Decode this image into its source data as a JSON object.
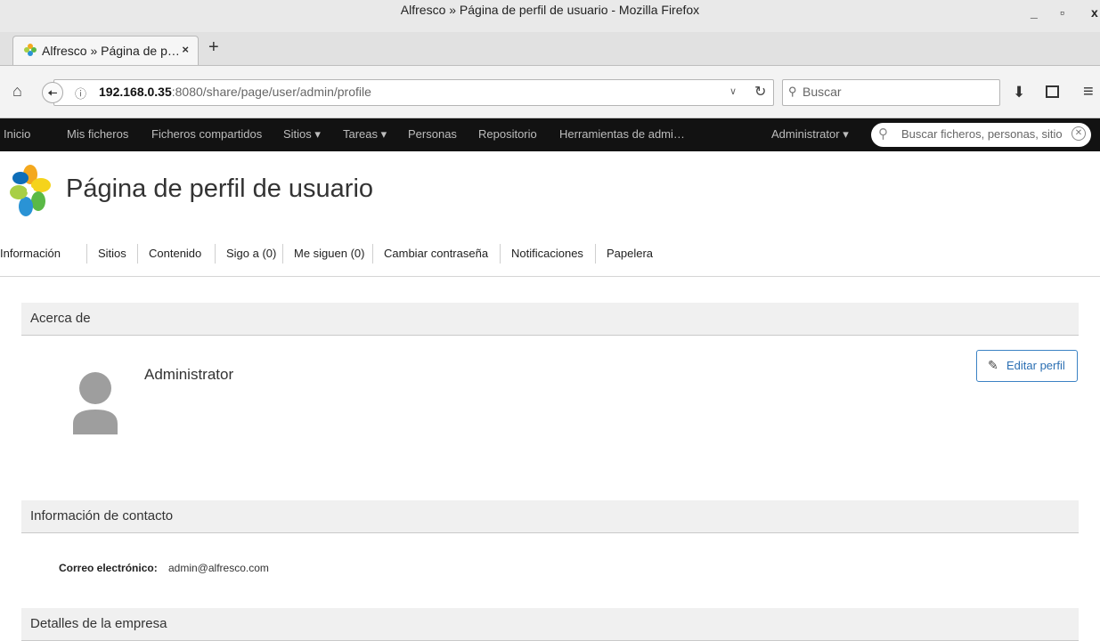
{
  "window": {
    "title": "Alfresco » Página de perfil de usuario - Mozilla Firefox",
    "minimize": "_",
    "maximize": "▫",
    "close": "x"
  },
  "browser": {
    "tab_title": "Alfresco » Página de p…",
    "tab_close": "×",
    "new_tab": "+",
    "url_host": "192.168.0.35",
    "url_rest": ":8080/share/page/user/admin/profile",
    "search_placeholder": "Buscar"
  },
  "app_nav": {
    "items": [
      "Inicio",
      "Mis ficheros",
      "Ficheros compartidos",
      "Sitios ▾",
      "Tareas ▾",
      "Personas",
      "Repositorio",
      "Herramientas de admi…"
    ],
    "user_menu": "Administrator ▾",
    "search_placeholder": "Buscar ficheros, personas, sitios"
  },
  "page": {
    "title": "Página de perfil de usuario"
  },
  "profile_tabs": [
    "Información",
    "Sitios",
    "Contenido",
    "Sigo a (0)",
    "Me siguen (0)",
    "Cambiar contraseña",
    "Notificaciones",
    "Papelera"
  ],
  "about": {
    "heading": "Acerca de",
    "name": "Administrator",
    "edit_label": "Editar perfil"
  },
  "contact": {
    "heading": "Información de contacto",
    "email_label": "Correo electrónico:",
    "email_value": "admin@alfresco.com"
  },
  "company": {
    "heading": "Detalles de la empresa"
  },
  "colors": {
    "nav_bg": "#121212",
    "section_bg": "#f0f0f0",
    "accent": "#2b6fb3"
  }
}
